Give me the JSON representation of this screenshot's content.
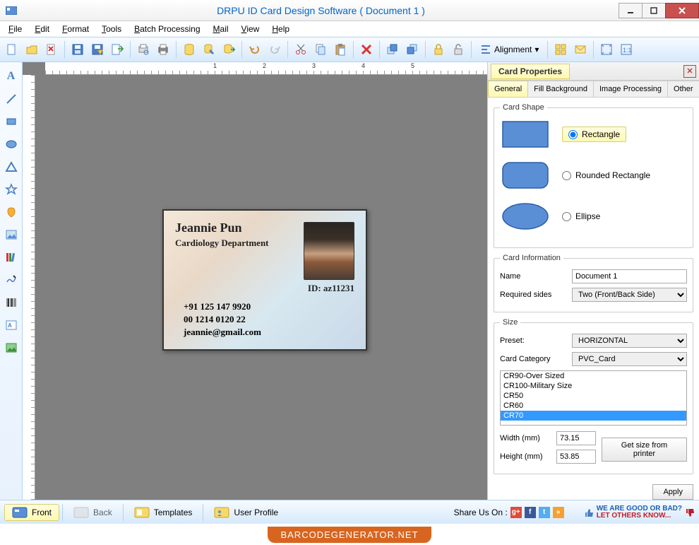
{
  "window": {
    "title": "DRPU ID Card Design Software ( Document 1 )"
  },
  "menu": [
    "File",
    "Edit",
    "Format",
    "Tools",
    "Batch Processing",
    "Mail",
    "View",
    "Help"
  ],
  "toolbar": {
    "alignment_label": "Alignment"
  },
  "ruler": {
    "labels": [
      "1",
      "2",
      "3",
      "4",
      "5"
    ]
  },
  "card": {
    "name": "Jeannie Pun",
    "department": "Cardiology Department",
    "id_label": "ID: az11231",
    "phone1": "+91 125 147 9920",
    "phone2": "00 1214 0120 22",
    "email": "jeannie@gmail.com"
  },
  "props": {
    "title": "Card Properties",
    "tabs": [
      "General",
      "Fill Background",
      "Image Processing",
      "Other"
    ],
    "active_tab": 0,
    "card_shape": {
      "legend": "Card Shape",
      "options": [
        "Rectangle",
        "Rounded Rectangle",
        "Ellipse"
      ],
      "selected": 0
    },
    "card_info": {
      "legend": "Card Information",
      "name_label": "Name",
      "name_value": "Document 1",
      "sides_label": "Required sides",
      "sides_value": "Two (Front/Back Side)"
    },
    "size": {
      "legend": "Size",
      "preset_label": "Preset:",
      "preset_value": "HORIZONTAL",
      "category_label": "Card Category",
      "category_value": "PVC_Card",
      "list": [
        "CR90-Over Sized",
        "CR100-Military Size",
        "CR50",
        "CR60",
        "CR70"
      ],
      "selected_index": 4,
      "width_label": "Width  (mm)",
      "width_value": "73.15",
      "height_label": "Height (mm)",
      "height_value": "53.85",
      "printer_btn": "Get size from printer"
    },
    "apply_label": "Apply"
  },
  "bottom": {
    "front": "Front",
    "back": "Back",
    "templates": "Templates",
    "user_profile": "User Profile",
    "share_label": "Share Us On :",
    "good_bad_l1": "WE ARE GOOD OR BAD?",
    "good_bad_l2": "LET OTHERS KNOW..."
  },
  "footer": {
    "brand": "BARCODEGENERATOR.NET"
  }
}
